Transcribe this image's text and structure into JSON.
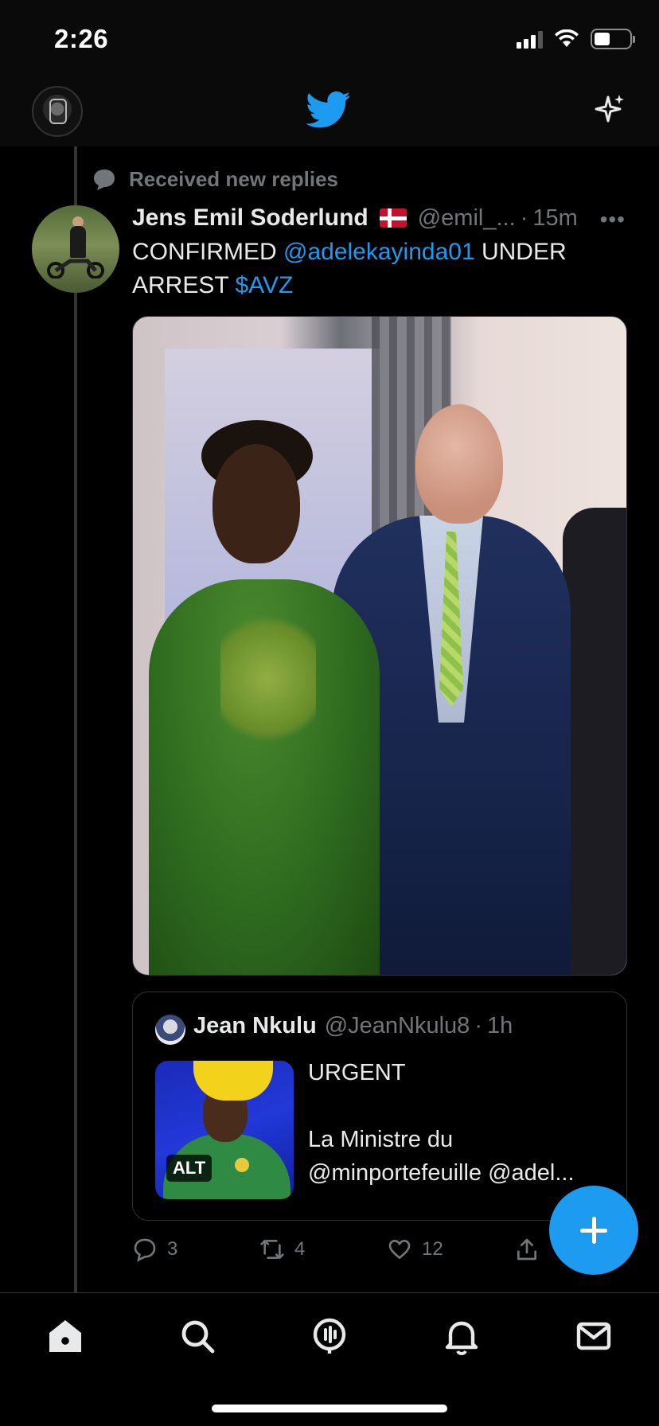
{
  "status_bar": {
    "time": "2:26",
    "battery_level": 0.45,
    "signal_bars": 3
  },
  "top_nav": {
    "center_icon": "twitter-bird-icon",
    "right_icon": "sparkle-icon",
    "brand_color": "#1d9bf0"
  },
  "tweet": {
    "context": "Received new replies",
    "author_name": "Jens Emil Soderlund",
    "author_flag": "danish-flag-icon",
    "handle": "@emil_...",
    "separator": "·",
    "age": "15m",
    "more": "•••",
    "text_prefix": "CONFIRMED ",
    "mention": "@adelekayinda01",
    "text_middle": " UNDER ARREST ",
    "cashtag": "$AVZ",
    "quote": {
      "author_name": "Jean Nkulu",
      "handle": "@JeanNkulu8",
      "separator": "·",
      "age": "1h",
      "alt_badge": "ALT",
      "text": "URGENT\n\nLa Ministre du @minportefeuille @adel..."
    },
    "actions": {
      "replies": "3",
      "retweets": "4",
      "likes": "12"
    }
  },
  "tab_bar": {
    "tabs": [
      "home",
      "search",
      "spaces",
      "notifications",
      "messages"
    ],
    "active": "home"
  },
  "colors": {
    "link": "#1d9bf0",
    "muted": "#71767b",
    "text": "#e7e9ea",
    "background": "#000000"
  }
}
